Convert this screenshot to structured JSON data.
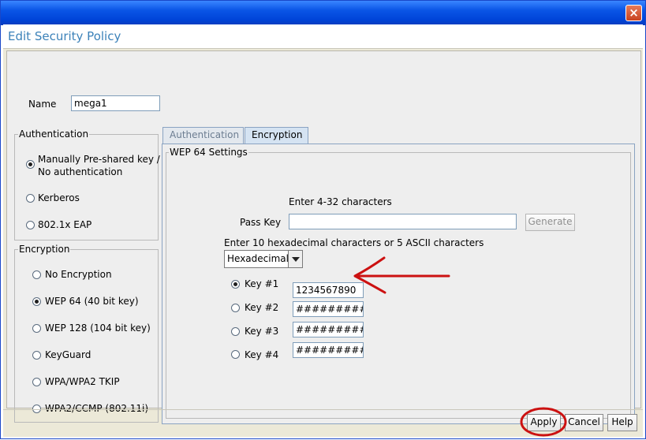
{
  "window": {
    "title": "",
    "close_glyph": "×"
  },
  "dialog": {
    "title": "Edit Security Policy"
  },
  "name": {
    "label": "Name",
    "value": "mega1"
  },
  "authentication": {
    "title": "Authentication",
    "options": [
      {
        "label": "Manually Pre-shared key /",
        "label2": "No authentication",
        "selected": true
      },
      {
        "label": "Kerberos",
        "selected": false
      },
      {
        "label": "802.1x EAP",
        "selected": false
      }
    ]
  },
  "encryption": {
    "title": "Encryption",
    "options": [
      {
        "label": "No Encryption",
        "selected": false
      },
      {
        "label": "WEP 64 (40 bit key)",
        "selected": true
      },
      {
        "label": "WEP 128 (104 bit key)",
        "selected": false
      },
      {
        "label": "KeyGuard",
        "selected": false
      },
      {
        "label": "WPA/WPA2 TKIP",
        "selected": false
      },
      {
        "label": "WPA2/CCMP (802.11i)",
        "selected": false
      }
    ]
  },
  "tabs": [
    {
      "label": "Authentication",
      "active": false
    },
    {
      "label": "Encryption",
      "active": true
    }
  ],
  "wep": {
    "title": "WEP  64 Settings",
    "passkey_hint": "Enter 4-32 characters",
    "passkey_label": "Pass Key",
    "passkey_value": "",
    "generate_label": "Generate",
    "key_hint": "Enter 10 hexadecimal characters or 5 ASCII characters",
    "format_selected": "Hexadecimal",
    "keys": [
      {
        "label": "Key #1",
        "value": "1234567890",
        "selected": true
      },
      {
        "label": "Key #2",
        "value": "##########",
        "selected": false
      },
      {
        "label": "Key #3",
        "value": "##########",
        "selected": false
      },
      {
        "label": "Key #4",
        "value": "##########",
        "selected": false
      }
    ]
  },
  "buttons": {
    "apply": "Apply",
    "cancel": "Cancel",
    "help": "Help"
  },
  "colors": {
    "title_accent": "#3c82b9",
    "annotation": "#cc1111"
  }
}
